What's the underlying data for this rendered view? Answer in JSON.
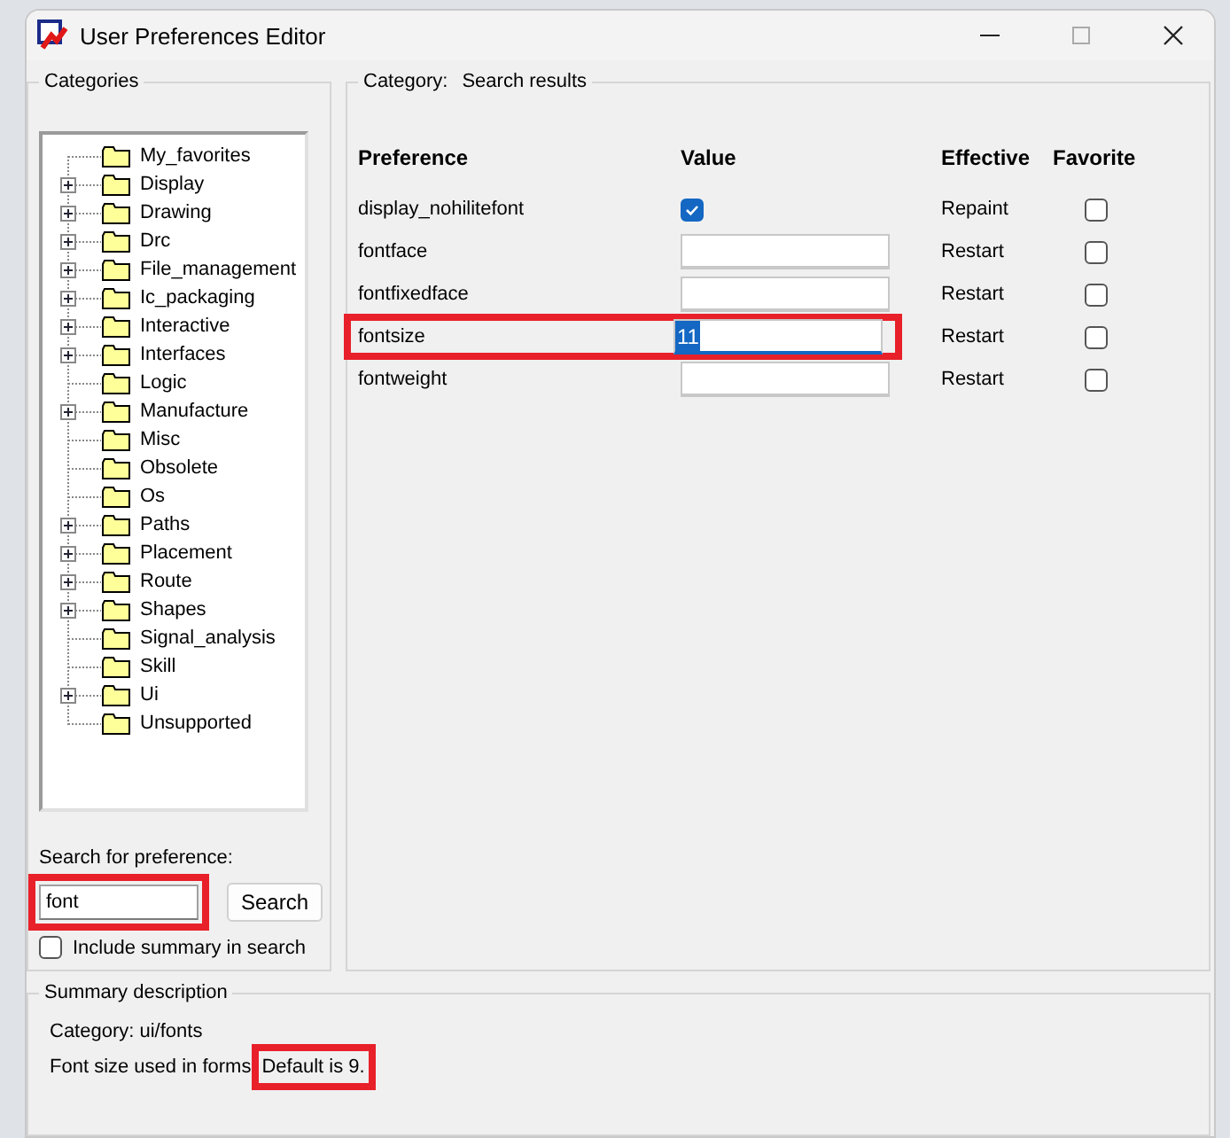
{
  "window": {
    "title": "User Preferences Editor"
  },
  "categories": {
    "title": "Categories",
    "items": [
      {
        "label": "My_favorites",
        "expandable": false
      },
      {
        "label": "Display",
        "expandable": true
      },
      {
        "label": "Drawing",
        "expandable": true
      },
      {
        "label": "Drc",
        "expandable": true
      },
      {
        "label": "File_management",
        "expandable": true
      },
      {
        "label": "Ic_packaging",
        "expandable": true
      },
      {
        "label": "Interactive",
        "expandable": true
      },
      {
        "label": "Interfaces",
        "expandable": true
      },
      {
        "label": "Logic",
        "expandable": false
      },
      {
        "label": "Manufacture",
        "expandable": true
      },
      {
        "label": "Misc",
        "expandable": false
      },
      {
        "label": "Obsolete",
        "expandable": false
      },
      {
        "label": "Os",
        "expandable": false
      },
      {
        "label": "Paths",
        "expandable": true
      },
      {
        "label": "Placement",
        "expandable": true
      },
      {
        "label": "Route",
        "expandable": true
      },
      {
        "label": "Shapes",
        "expandable": true
      },
      {
        "label": "Signal_analysis",
        "expandable": false
      },
      {
        "label": "Skill",
        "expandable": false
      },
      {
        "label": "Ui",
        "expandable": true
      },
      {
        "label": "Unsupported",
        "expandable": false
      }
    ]
  },
  "search": {
    "label": "Search for preference:",
    "value": "font",
    "highlighted": true,
    "button": "Search",
    "include_summary": {
      "label": "Include summary in search",
      "checked": false
    }
  },
  "results": {
    "category_label": "Category:",
    "category": "Search results",
    "columns": [
      "Preference",
      "Value",
      "Effective",
      "Favorite"
    ],
    "rows": [
      {
        "name": "display_nohilitefont",
        "kind": "checkbox",
        "checked": true,
        "effective": "Repaint",
        "favorite": false,
        "highlighted": false
      },
      {
        "name": "fontface",
        "kind": "text",
        "value": "",
        "effective": "Restart",
        "favorite": false,
        "highlighted": false
      },
      {
        "name": "fontfixedface",
        "kind": "text",
        "value": "",
        "effective": "Restart",
        "favorite": false,
        "highlighted": false
      },
      {
        "name": "fontsize",
        "kind": "text",
        "value": "11",
        "selected": true,
        "effective": "Restart",
        "favorite": false,
        "highlighted": true
      },
      {
        "name": "fontweight",
        "kind": "text",
        "value": "",
        "effective": "Restart",
        "favorite": false,
        "highlighted": false
      }
    ]
  },
  "summary": {
    "title": "Summary description",
    "category": "Category: ui/fonts",
    "text": "Font size used in forms",
    "note": "Default is 9.",
    "note_highlighted": true
  }
}
